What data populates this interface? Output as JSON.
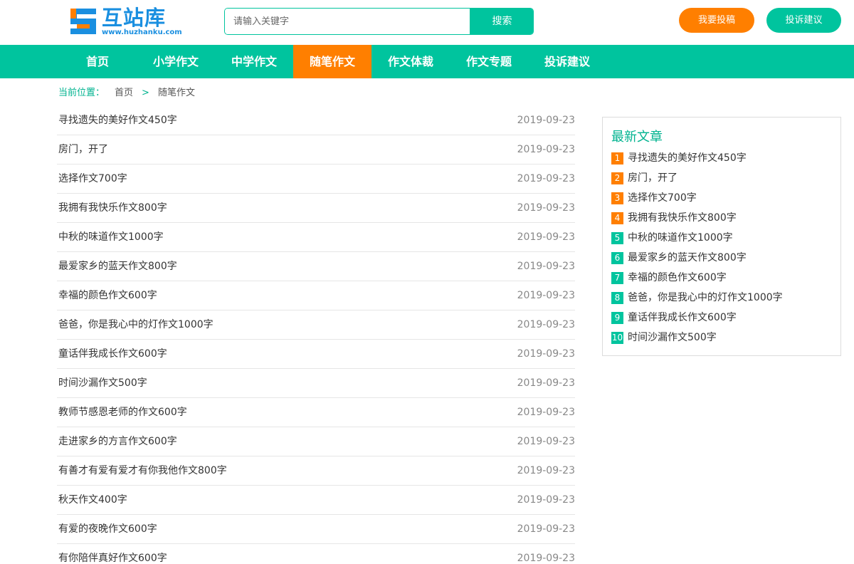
{
  "header": {
    "logo_text": "互站库",
    "logo_url_text": "www.huzhanku.com",
    "search_placeholder": "请输入关键字",
    "search_button": "搜索",
    "submit_button": "我要投稿",
    "complain_button": "投诉建议"
  },
  "nav": {
    "items": [
      {
        "label": "首页"
      },
      {
        "label": "小学作文"
      },
      {
        "label": "中学作文"
      },
      {
        "label": "随笔作文"
      },
      {
        "label": "作文体裁"
      },
      {
        "label": "作文专题"
      },
      {
        "label": "投诉建议"
      }
    ],
    "active_index": 3
  },
  "breadcrumb": {
    "label": "当前位置：",
    "home": "首页",
    "separator": ">",
    "current": "随笔作文"
  },
  "articles": [
    {
      "title": "寻找遗失的美好作文450字",
      "date": "2019-09-23"
    },
    {
      "title": "房门，开了",
      "date": "2019-09-23"
    },
    {
      "title": "选择作文700字",
      "date": "2019-09-23"
    },
    {
      "title": "我拥有我快乐作文800字",
      "date": "2019-09-23"
    },
    {
      "title": "中秋的味道作文1000字",
      "date": "2019-09-23"
    },
    {
      "title": "最爱家乡的蓝天作文800字",
      "date": "2019-09-23"
    },
    {
      "title": "幸福的颜色作文600字",
      "date": "2019-09-23"
    },
    {
      "title": "爸爸，你是我心中的灯作文1000字",
      "date": "2019-09-23"
    },
    {
      "title": "童话伴我成长作文600字",
      "date": "2019-09-23"
    },
    {
      "title": "时间沙漏作文500字",
      "date": "2019-09-23"
    },
    {
      "title": "教师节感恩老师的作文600字",
      "date": "2019-09-23"
    },
    {
      "title": "走进家乡的方言作文600字",
      "date": "2019-09-23"
    },
    {
      "title": "有善才有爱有爱才有你我他作文800字",
      "date": "2019-09-23"
    },
    {
      "title": "秋天作文400字",
      "date": "2019-09-23"
    },
    {
      "title": "有爱的夜晚作文600字",
      "date": "2019-09-23"
    },
    {
      "title": "有你陪伴真好作文600字",
      "date": "2019-09-23"
    }
  ],
  "sidebar": {
    "title": "最新文章",
    "items": [
      {
        "rank": "1",
        "title": "寻找遗失的美好作文450字",
        "color": "orange"
      },
      {
        "rank": "2",
        "title": "房门，开了",
        "color": "orange"
      },
      {
        "rank": "3",
        "title": "选择作文700字",
        "color": "orange"
      },
      {
        "rank": "4",
        "title": "我拥有我快乐作文800字",
        "color": "orange"
      },
      {
        "rank": "5",
        "title": "中秋的味道作文1000字",
        "color": "green"
      },
      {
        "rank": "6",
        "title": "最爱家乡的蓝天作文800字",
        "color": "green"
      },
      {
        "rank": "7",
        "title": "幸福的颜色作文600字",
        "color": "green"
      },
      {
        "rank": "8",
        "title": "爸爸，你是我心中的灯作文1000字",
        "color": "green"
      },
      {
        "rank": "9",
        "title": "童话伴我成长作文600字",
        "color": "green"
      },
      {
        "rank": "10",
        "title": "时间沙漏作文500字",
        "color": "green"
      }
    ]
  },
  "colors": {
    "accent_green": "#00c49e",
    "accent_orange": "#ff7f00",
    "logo_blue": "#1a8fe0"
  }
}
